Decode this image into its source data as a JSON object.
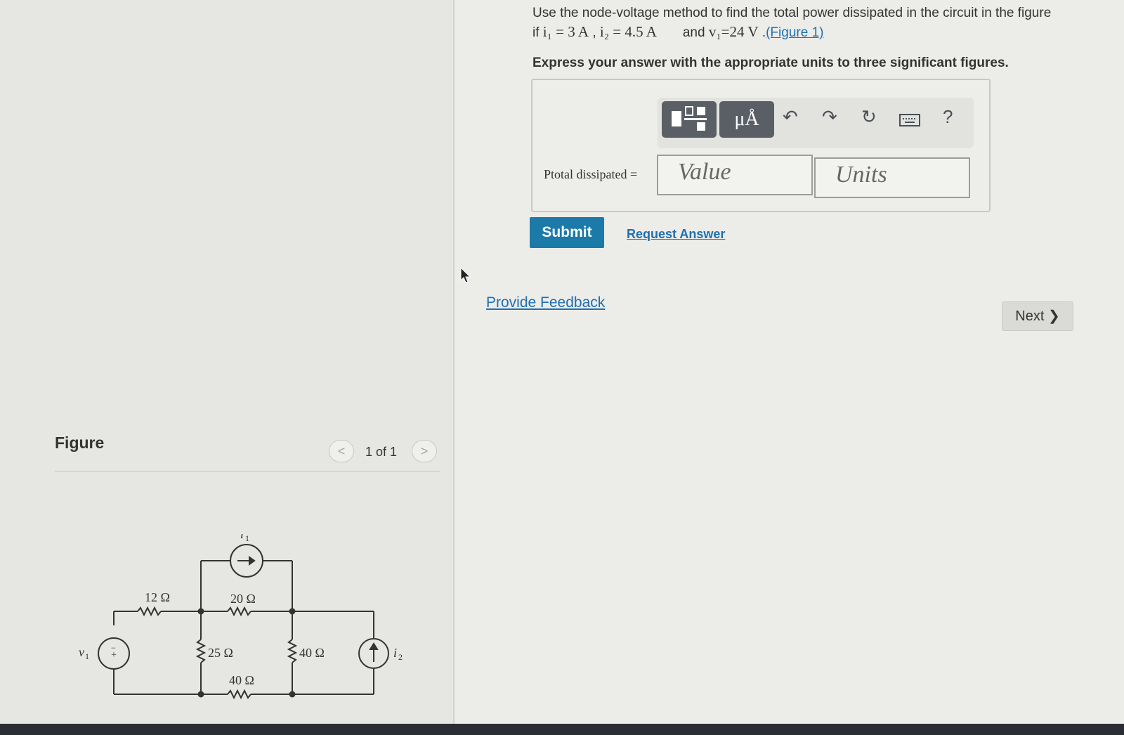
{
  "figure_panel": {
    "title": "Figure",
    "pager_prev": "<",
    "pager_count": "1 of 1",
    "pager_next": ">"
  },
  "circuit": {
    "labels": {
      "v1": "v",
      "v1_sub": "1",
      "i1": "i",
      "i1_sub": "1",
      "i2": "i",
      "i2_sub": "2",
      "r12": "12 Ω",
      "r20": "20 Ω",
      "r25": "25 Ω",
      "r40_bottom": "40 Ω",
      "r40_right": "40 Ω",
      "plus": "+",
      "minus": "−"
    }
  },
  "question": {
    "line1": "Use the node-voltage method to find the total power dissipated in the circuit in the figure",
    "line2_prefix": "if ",
    "i1_expr": "i₁ = 3 A",
    "sep": " , ",
    "i2_expr": "i₂ = 4.5 A",
    "and": "and ",
    "v1_expr": "v₁=24 V",
    "dot": " .",
    "figure_link": "(Figure 1)",
    "instruction": "Express your answer with the appropriate units to three significant figures."
  },
  "toolbar": {
    "units_button": "μÅ",
    "help": "?"
  },
  "answer": {
    "label": "Ptotal dissipated =",
    "value_placeholder": "Value",
    "units_placeholder": "Units"
  },
  "actions": {
    "submit": "Submit",
    "request": "Request Answer",
    "feedback": "Provide Feedback",
    "next": "Next ❯"
  },
  "colors": {
    "submit": "#1c7aa8",
    "link": "#1f6fb0",
    "toolbar_button": "#5a5f66"
  }
}
